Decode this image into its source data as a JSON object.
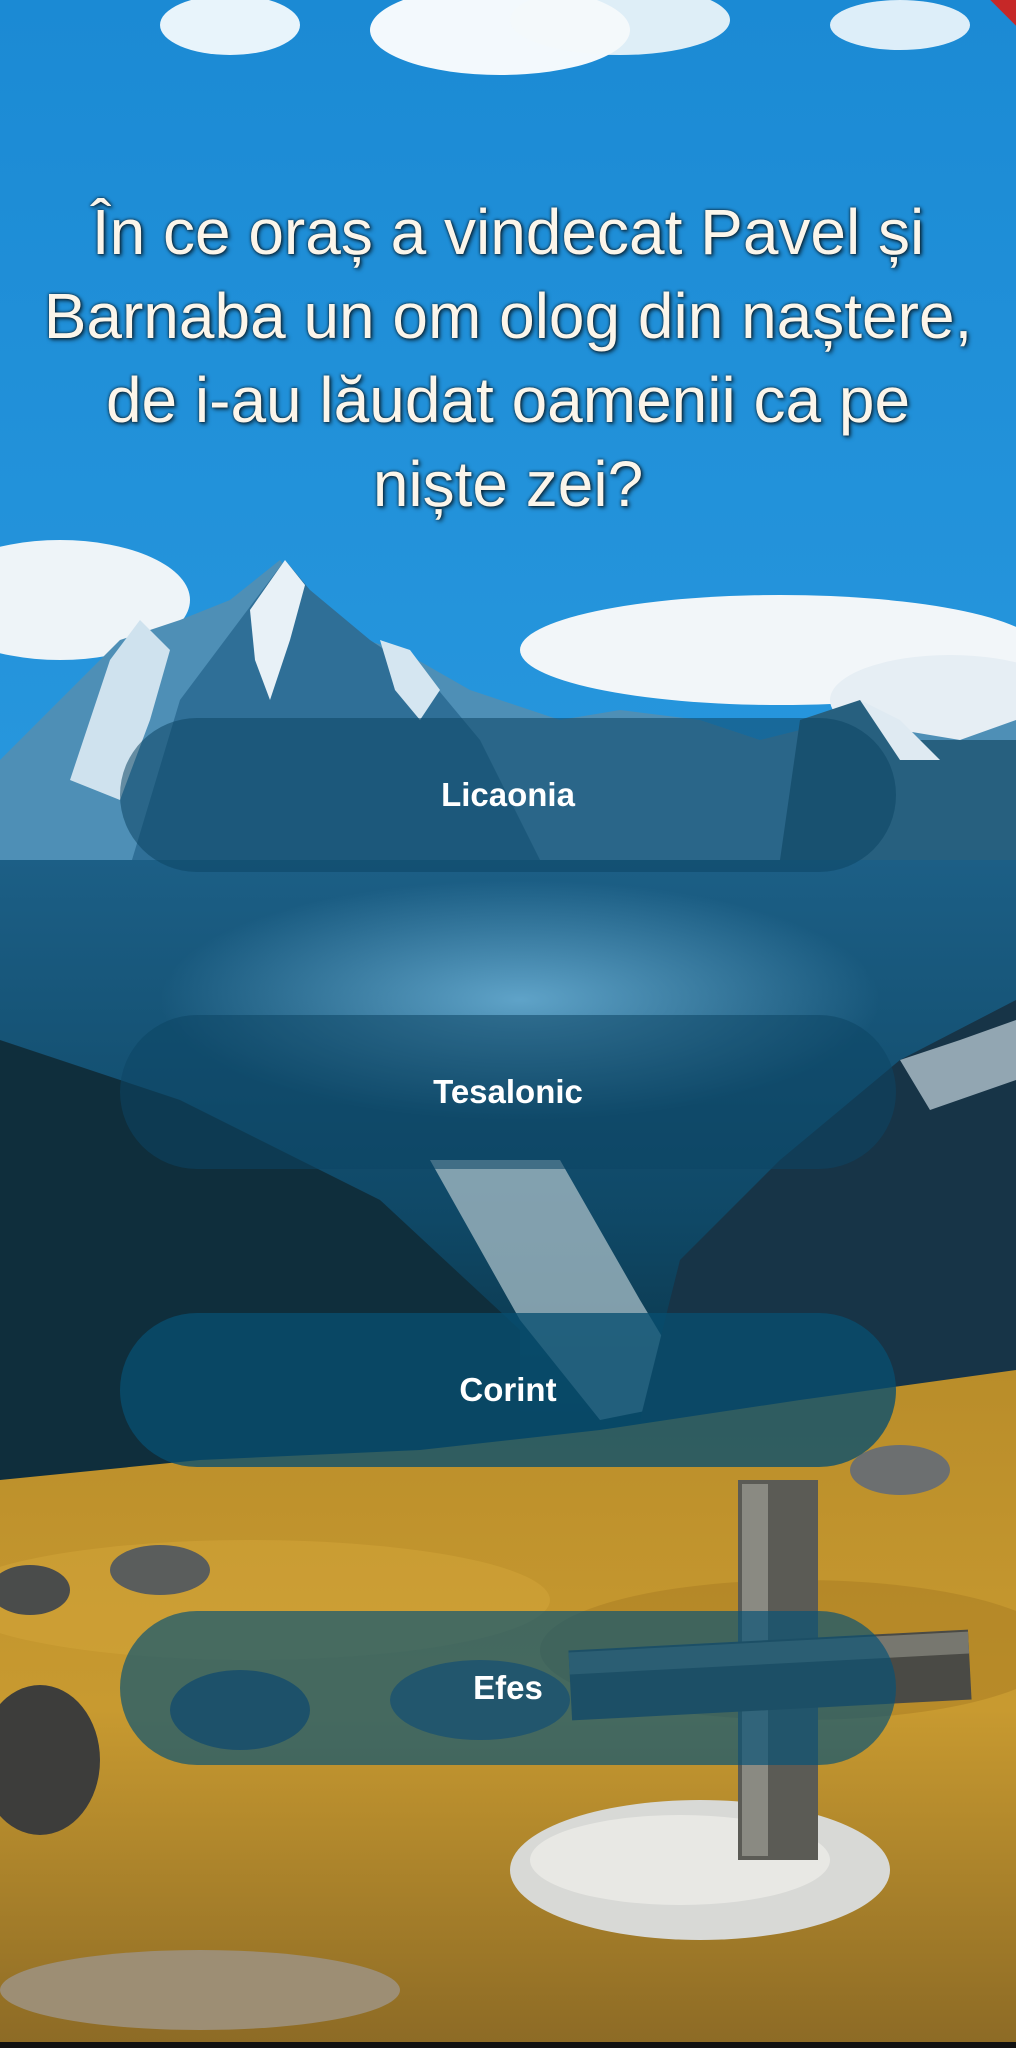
{
  "question": {
    "text": "În ce oraș a vindecat Pavel și Barnaba un om olog din naștere, de i-au lăudat oamenii ca pe niște zei?"
  },
  "answers": [
    {
      "label": "Licaonia"
    },
    {
      "label": "Tesalonic"
    },
    {
      "label": "Corint"
    },
    {
      "label": "Efes"
    }
  ],
  "colors": {
    "sky": "#1f8fd6",
    "answer_bg": "#0a4866",
    "text": "#ffffff"
  }
}
